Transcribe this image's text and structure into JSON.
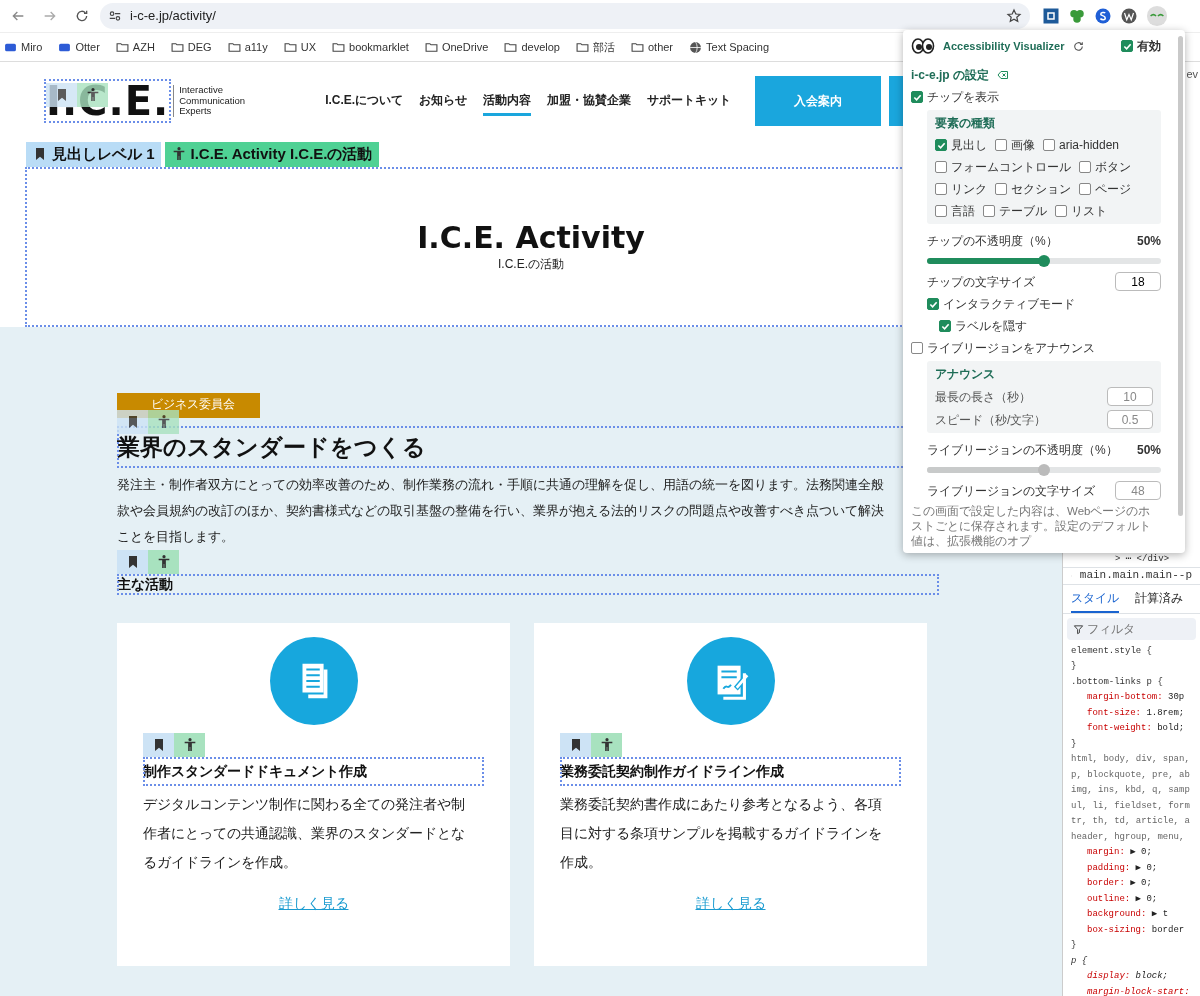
{
  "browser": {
    "url": "i-c-e.jp/activity/",
    "bookmarks": [
      {
        "label": "Miro",
        "kind": "app"
      },
      {
        "label": "Otter",
        "kind": "app"
      },
      {
        "label": "AZH",
        "kind": "folder"
      },
      {
        "label": "DEG",
        "kind": "folder"
      },
      {
        "label": "a11y",
        "kind": "folder"
      },
      {
        "label": "UX",
        "kind": "folder"
      },
      {
        "label": "bookmarklet",
        "kind": "folder"
      },
      {
        "label": "OneDrive",
        "kind": "folder"
      },
      {
        "label": "develop",
        "kind": "folder"
      },
      {
        "label": "部活",
        "kind": "folder"
      },
      {
        "label": "other",
        "kind": "folder"
      },
      {
        "label": "Text Spacing",
        "kind": "site"
      }
    ]
  },
  "page": {
    "logo": {
      "mark": "I.C.E.",
      "tagline": [
        "Interactive",
        "Communication",
        "Experts"
      ]
    },
    "nav": [
      {
        "label": "I.C.E.について",
        "selected": false
      },
      {
        "label": "お知らせ",
        "selected": false
      },
      {
        "label": "活動内容",
        "selected": true
      },
      {
        "label": "加盟・協賛企業",
        "selected": false
      },
      {
        "label": "サポートキット",
        "selected": false
      }
    ],
    "buttons": [
      "入会案内"
    ],
    "chips": [
      {
        "kind": "heading",
        "label": "見出しレベル 1"
      },
      {
        "kind": "name",
        "label": "I.C.E. Activity I.C.E.の活動"
      }
    ],
    "hero": {
      "title": "I.C.E. Activity",
      "subtitle": "I.C.E.の活動"
    },
    "section": {
      "category": "ビジネス委員会",
      "heading": "業界のスタンダードをつくる",
      "paragraph_lines": [
        "発注主・制作者双方にとっての効率改善のため、制作業務の流れ・手順に共通の理解を促し、用語の統一を図ります。法務関連全般",
        "款や会員規約の改訂のほか、契約書様式などの取引基盤の整備を行い、業界が抱える法的リスクの問題点や改善すべき点ついて解決",
        "ことを目指します。"
      ],
      "subheading": "主な活動",
      "cards": [
        {
          "kind": "document",
          "title": "制作スタンダードドキュメント作成",
          "text": "デジタルコンテンツ制作に関わる全ての発注者や制作者にとっての共通認識、業界のスタンダードとなるガイドラインを作成。",
          "link": "詳しく見る"
        },
        {
          "kind": "contract",
          "title": "業務委託契約制作ガイドライン作成",
          "text": "業務委託契約書作成にあたり参考となるよう、各項目に対する条項サンプルを掲載するガイドラインを作成。",
          "link": "詳しく見る"
        }
      ]
    }
  },
  "popup": {
    "title": "Accessibility Visualizer",
    "enabled": {
      "label": "有効",
      "checked": true
    },
    "site_settings": "i-c-e.jp の設定",
    "show_chips": {
      "label": "チップを表示",
      "checked": true
    },
    "types_title": "要素の種類",
    "types": [
      [
        {
          "label": "見出し",
          "checked": true
        },
        {
          "label": "画像",
          "checked": false
        },
        {
          "label": "aria-hidden",
          "checked": false
        }
      ],
      [
        {
          "label": "フォームコントロール",
          "checked": false
        },
        {
          "label": "ボタン",
          "checked": false
        }
      ],
      [
        {
          "label": "リンク",
          "checked": false
        },
        {
          "label": "セクション",
          "checked": false
        },
        {
          "label": "ページ",
          "checked": false
        }
      ],
      [
        {
          "label": "言語",
          "checked": false
        },
        {
          "label": "テーブル",
          "checked": false
        },
        {
          "label": "リスト",
          "checked": false
        }
      ]
    ],
    "chip_opacity": {
      "label": "チップの不透明度（%）",
      "reading": "50%",
      "level": 0.5,
      "disabled": false
    },
    "chip_size": {
      "label": "チップの文字サイズ",
      "value": "18"
    },
    "interactive": {
      "label": "インタラクティブモード",
      "checked": true
    },
    "hide_labels": {
      "label": "ラベルを隠す",
      "checked": true
    },
    "announce": {
      "label": "ライブリージョンをアナウンス",
      "checked": false
    },
    "announce_group": {
      "title": "アナウンス",
      "fields": [
        {
          "label": "最長の長さ（秒）",
          "value": "10"
        },
        {
          "label": "スピード（秒/文字）",
          "value": "0.5"
        }
      ]
    },
    "live_opacity": {
      "label": "ライブリージョンの不透明度（%）",
      "reading": "50%",
      "level": 0.5,
      "disabled": true
    },
    "live_size": {
      "label": "ライブリージョンの文字サイズ",
      "value": "48"
    },
    "footer": "この画面で設定した内容は、Webページのホストごとに保存されます。設定のデフォルト値は、拡張機能のオプ"
  },
  "devtools": {
    "header": "ev",
    "node": "> ⋯ </div>",
    "breadcrumb": "main.main.main--p",
    "tabs": [
      {
        "label": "スタイル",
        "selected": true
      },
      {
        "label": "計算済み",
        "selected": false
      }
    ],
    "filter_placeholder": "フィルタ",
    "lines": [
      {
        "kind": "selector",
        "text": "element.style {"
      },
      {
        "kind": "brace",
        "text": "}"
      },
      {
        "kind": "selector",
        "text": ".bottom-links p {"
      },
      {
        "kind": "prop",
        "name": "margin-bottom:",
        "value": "30p"
      },
      {
        "kind": "prop",
        "name": "font-size:",
        "value": "1.8rem;"
      },
      {
        "kind": "prop",
        "name": "font-weight:",
        "value": "bold;"
      },
      {
        "kind": "brace",
        "text": "}"
      },
      {
        "kind": "selector",
        "text": "html, body, div, span,"
      },
      {
        "kind": "selector",
        "text": "p, blockquote, pre, ab"
      },
      {
        "kind": "selector",
        "text": "img, ins, kbd, q, samp"
      },
      {
        "kind": "selector",
        "text": "ul, li, fieldset, form"
      },
      {
        "kind": "selector",
        "text": "tr, th, td, article, a"
      },
      {
        "kind": "selector",
        "text": "header, hgroup, menu,"
      },
      {
        "kind": "prop",
        "name": "margin:",
        "value": "▶ 0;"
      },
      {
        "kind": "prop",
        "name": "padding:",
        "value": "▶ 0;"
      },
      {
        "kind": "prop",
        "name": "border:",
        "value": "▶ 0;"
      },
      {
        "kind": "prop",
        "name": "outline:",
        "value": "▶ 0;"
      },
      {
        "kind": "prop",
        "name": "background:",
        "value": "▶ t"
      },
      {
        "kind": "prop",
        "name": "box-sizing:",
        "value": "border"
      },
      {
        "kind": "brace",
        "text": "}"
      },
      {
        "kind": "ua-selector",
        "text": "p {"
      },
      {
        "kind": "ua-prop",
        "name": "display:",
        "value": "block;"
      },
      {
        "kind": "ua-prop",
        "name": "margin-block-start:"
      }
    ]
  }
}
